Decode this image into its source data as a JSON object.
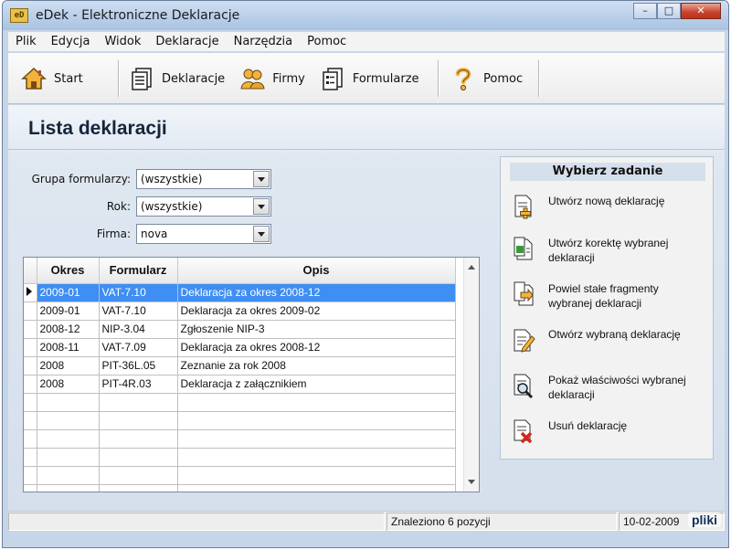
{
  "window": {
    "app_icon": "eD",
    "title": "eDek - Elektroniczne Deklaracje",
    "minimize": "–",
    "maximize": "□",
    "close": "✕"
  },
  "menu": [
    "Plik",
    "Edycja",
    "Widok",
    "Deklaracje",
    "Narzędzia",
    "Pomoc"
  ],
  "toolbar": {
    "start": "Start",
    "deklaracje": "Deklaracje",
    "firmy": "Firmy",
    "formularze": "Formularze",
    "pomoc": "Pomoc"
  },
  "page": {
    "title": "Lista deklaracji"
  },
  "filters": {
    "grupa": {
      "label": "Grupa formularzy:",
      "value": "(wszystkie)"
    },
    "rok": {
      "label": "Rok:",
      "value": "(wszystkie)"
    },
    "firma": {
      "label": "Firma:",
      "value": "nova"
    }
  },
  "table": {
    "headers": [
      "Okres",
      "Formularz",
      "Opis"
    ],
    "rows": [
      {
        "okres": "2009-01",
        "formularz": "VAT-7.10",
        "opis": "Deklaracja za okres 2008-12"
      },
      {
        "okres": "2009-01",
        "formularz": "VAT-7.10",
        "opis": "Deklaracja za okres 2009-02"
      },
      {
        "okres": "2008-12",
        "formularz": "NIP-3.04",
        "opis": "Zgłoszenie NIP-3"
      },
      {
        "okres": "2008-11",
        "formularz": "VAT-7.09",
        "opis": "Deklaracja za okres 2008-12"
      },
      {
        "okres": "2008",
        "formularz": "PIT-36L.05",
        "opis": "Zeznanie za rok 2008"
      },
      {
        "okres": "2008",
        "formularz": "PIT-4R.03",
        "opis": "Deklaracja z załącznikiem"
      }
    ],
    "empty_rows": 6,
    "selected_row": 0
  },
  "tasks": {
    "title": "Wybierz zadanie",
    "items": [
      {
        "label": "Utwórz nową deklarację",
        "icon": "new-document-icon"
      },
      {
        "label": "Utwórz korektę wybranej deklaracji",
        "icon": "correction-document-icon"
      },
      {
        "label": "Powiel stałe fragmenty wybranej deklaracji",
        "icon": "copy-document-icon"
      },
      {
        "label": "Otwórz wybraną deklarację",
        "icon": "edit-document-icon"
      },
      {
        "label": "Pokaż właściwości wybranej deklaracji",
        "icon": "properties-document-icon"
      },
      {
        "label": "Usuń deklarację",
        "icon": "delete-document-icon"
      }
    ]
  },
  "status": {
    "left": "",
    "count": "Znaleziono 6 pozycji",
    "date": "10-02-2009"
  },
  "watermark": "pliki",
  "colors": {
    "selection": "#3e8ef3",
    "window_frame": "#c6d5e8"
  }
}
